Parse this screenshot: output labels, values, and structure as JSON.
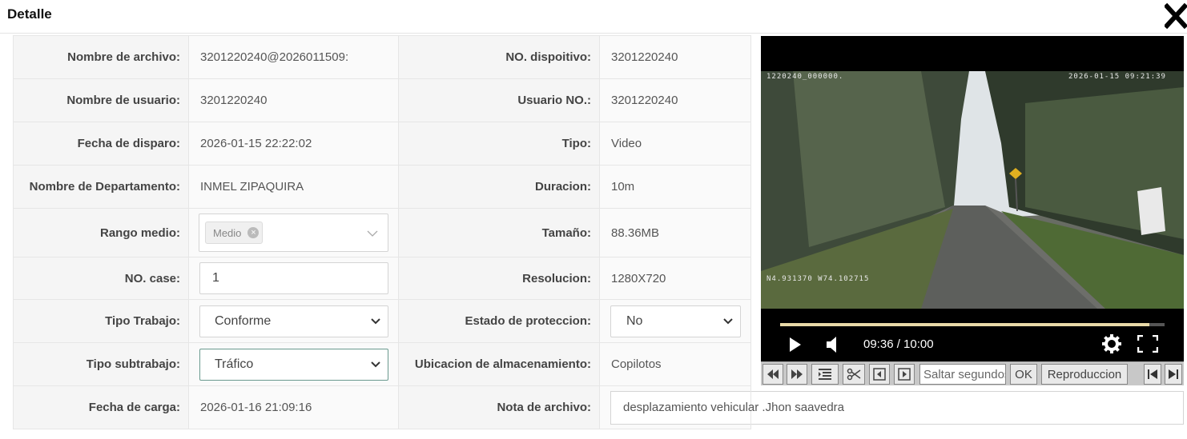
{
  "window": {
    "title": "Detalle"
  },
  "left": [
    {
      "label": "Nombre de archivo:",
      "value": "3201220240@2026011509:"
    },
    {
      "label": "Nombre de usuario:",
      "value": "3201220240"
    },
    {
      "label": "Fecha de disparo:",
      "value": "2026-01-15 22:22:02"
    },
    {
      "label": "Nombre de Departamento:",
      "value": "INMEL ZIPAQUIRA"
    },
    {
      "label": "Rango medio:",
      "tag": "Medio"
    },
    {
      "label": "NO. case:",
      "value": "1"
    },
    {
      "label": "Tipo Trabajo:",
      "value": "Conforme"
    },
    {
      "label": "Tipo subtrabajo:",
      "value": "Tráfico"
    },
    {
      "label": "Fecha de carga:",
      "value": "2026-01-16 21:09:16"
    }
  ],
  "right": [
    {
      "label": "NO. dispoitivo:",
      "value": "3201220240"
    },
    {
      "label": "Usuario NO.:",
      "value": "3201220240"
    },
    {
      "label": "Tipo:",
      "value": "Video"
    },
    {
      "label": "Duracion:",
      "value": "10m"
    },
    {
      "label": "Tamaño:",
      "value": "88.36MB"
    },
    {
      "label": "Resolucion:",
      "value": "1280X720"
    },
    {
      "label": "Estado de proteccion:",
      "value": "No"
    },
    {
      "label": "Ubicacion de almacenamiento:",
      "value": "Copilotos"
    },
    {
      "label": "Nota de archivo:",
      "value": "desplazamiento vehicular .Jhon saavedra"
    }
  ],
  "player": {
    "osd_top_left": "1220240_000000.",
    "osd_top_right": "2026-01-15 09:21:39",
    "osd_bottom_left": "N4.931370  W74.102715",
    "time": "09:36 / 10:00",
    "progress": 0.96
  },
  "toolbar": {
    "seek_placeholder": "Saltar segundos",
    "ok_label": "OK",
    "playback_label": "Reproduccion"
  },
  "colors": {
    "player_bg": "#000000",
    "progress_fill": "#e8d9a8",
    "toolbar_bg": "#c8c8c8"
  }
}
